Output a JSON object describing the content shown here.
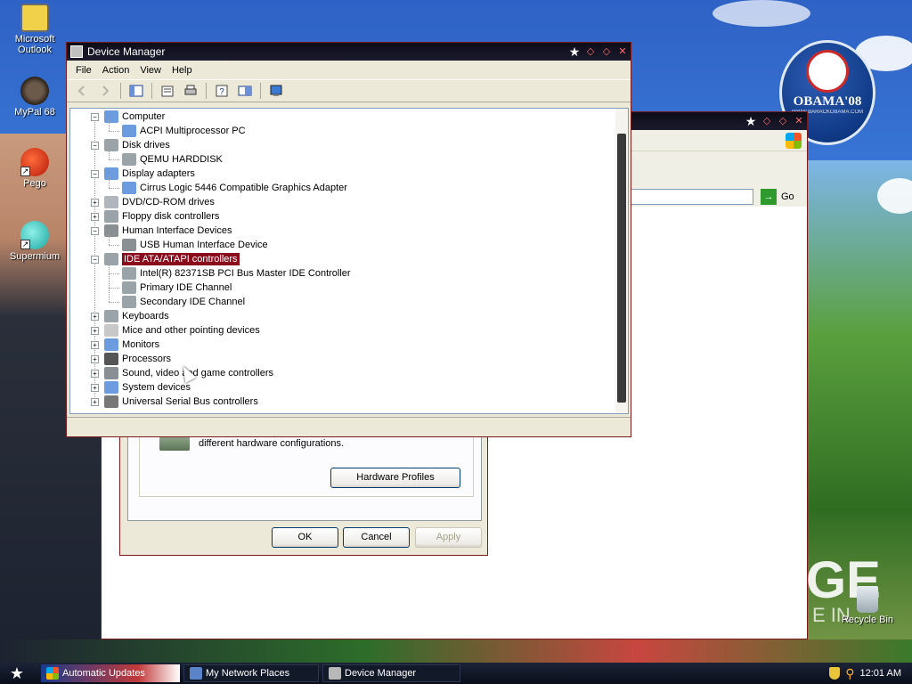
{
  "desktop": {
    "icons": [
      {
        "label": "Microsoft Outlook"
      },
      {
        "label": "MyPal 68"
      },
      {
        "label": "Pego"
      },
      {
        "label": "Supermium"
      },
      {
        "label": "Recycle Bin"
      }
    ],
    "poster": {
      "logo_text": "OBAMA'08",
      "logo_sub": "WWW.BARACKOBAMA.COM",
      "big_text": "GE",
      "small_text": "E IN"
    }
  },
  "browser": {
    "go_label": "Go"
  },
  "system_properties": {
    "description": "different hardware configurations.",
    "hardware_profiles_button": "Hardware Profiles",
    "ok_button": "OK",
    "cancel_button": "Cancel",
    "apply_button": "Apply"
  },
  "device_manager": {
    "title": "Device Manager",
    "menu": [
      "File",
      "Action",
      "View",
      "Help"
    ],
    "tree": [
      {
        "label": "Computer",
        "expanded": true,
        "children": [
          "ACPI Multiprocessor PC"
        ]
      },
      {
        "label": "Disk drives",
        "expanded": true,
        "children": [
          "QEMU HARDDISK"
        ]
      },
      {
        "label": "Display adapters",
        "expanded": true,
        "children": [
          "Cirrus Logic 5446 Compatible Graphics Adapter"
        ]
      },
      {
        "label": "DVD/CD-ROM drives",
        "expanded": false
      },
      {
        "label": "Floppy disk controllers",
        "expanded": false
      },
      {
        "label": "Human Interface Devices",
        "expanded": true,
        "children": [
          "USB Human Interface Device"
        ]
      },
      {
        "label": "IDE ATA/ATAPI controllers",
        "expanded": true,
        "selected": true,
        "children": [
          "Intel(R) 82371SB PCI Bus Master IDE Controller",
          "Primary IDE Channel",
          "Secondary IDE Channel"
        ]
      },
      {
        "label": "Keyboards",
        "expanded": false
      },
      {
        "label": "Mice and other pointing devices",
        "expanded": false
      },
      {
        "label": "Monitors",
        "expanded": false
      },
      {
        "label": "Processors",
        "expanded": false
      },
      {
        "label": "Sound, video and game controllers",
        "expanded": false
      },
      {
        "label": "System devices",
        "expanded": false
      },
      {
        "label": "Universal Serial Bus controllers",
        "expanded": false
      }
    ]
  },
  "taskbar": {
    "tasks": [
      "Automatic Updates",
      "My Network Places",
      "Device Manager"
    ],
    "clock": "12:01 AM"
  },
  "colors": {
    "selection": "#8b0c1c",
    "titlebar": "#0c0c18",
    "window_border": "#7b1a1a"
  }
}
